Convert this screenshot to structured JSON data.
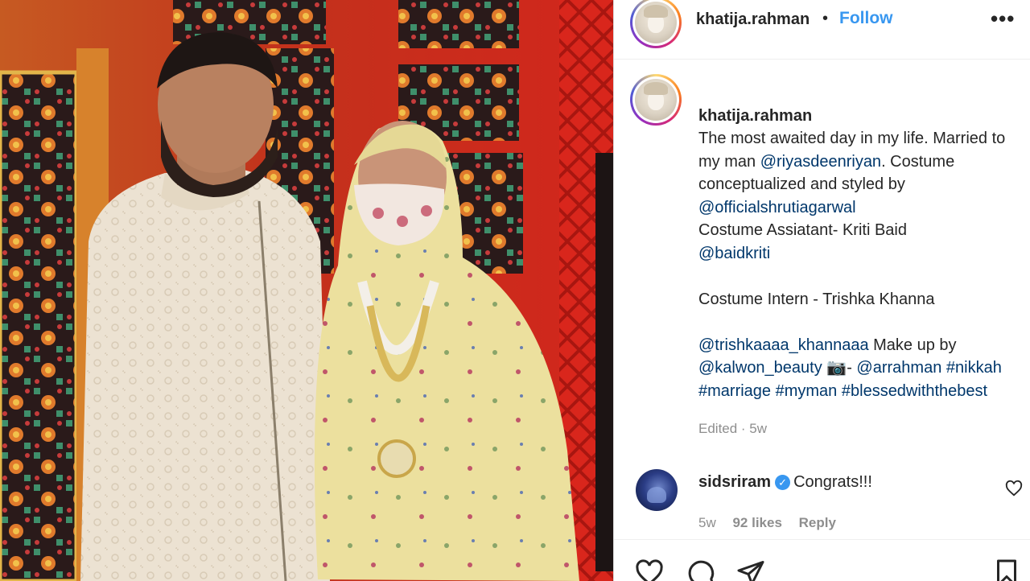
{
  "post": {
    "author": "khatija.rahman",
    "separator": "•",
    "follow_label": "Follow",
    "more_label": "•••"
  },
  "caption": {
    "username": "khatija.rahman",
    "segments": [
      {
        "text": " The most awaited day in my life. Married to my man ",
        "link": false
      },
      {
        "text": "@riyasdeenriyan",
        "link": true
      },
      {
        "text": ". Costume conceptualized and styled by ",
        "link": false
      },
      {
        "text": "@officialshrutiagarwal",
        "link": true
      },
      {
        "text": "\nCostume Assiatant- Kriti Baid\n",
        "link": false
      },
      {
        "text": "@baidkriti",
        "link": true
      },
      {
        "text": "\n\nCostume Intern - Trishka Khanna\n\n",
        "link": false
      },
      {
        "text": "@trishkaaaa_khannaaa",
        "link": true
      },
      {
        "text": " Make up by ",
        "link": false
      },
      {
        "text": "@kalwon_beauty",
        "link": true
      },
      {
        "text": " 📷- ",
        "link": false
      },
      {
        "text": "@arrahman",
        "link": true
      },
      {
        "text": " ",
        "link": false
      },
      {
        "text": "#nikkah",
        "link": true
      },
      {
        "text": " ",
        "link": false
      },
      {
        "text": "#marriage",
        "link": true
      },
      {
        "text": " ",
        "link": false
      },
      {
        "text": "#myman",
        "link": true
      },
      {
        "text": " ",
        "link": false
      },
      {
        "text": "#blessedwiththebest",
        "link": true
      }
    ],
    "edited": "Edited · 5w"
  },
  "comment": {
    "username": "sidsriram",
    "verified_glyph": "✓",
    "text": "Congrats!!!",
    "age": "5w",
    "likes": "92 likes",
    "reply_label": "Reply"
  },
  "icons": {
    "like": "heart-icon",
    "comment": "comment-icon",
    "share": "share-icon",
    "save": "bookmark-icon"
  },
  "colors": {
    "link": "#00376b",
    "follow": "#3897f0",
    "muted": "#8e8e8e"
  }
}
